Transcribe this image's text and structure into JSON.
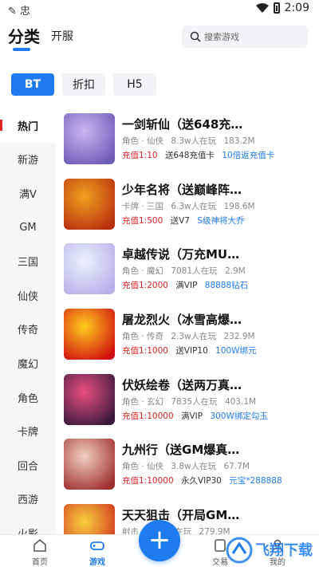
{
  "status_bar": {
    "left_icons": "✎ 忠",
    "time": "2:09"
  },
  "top_nav": {
    "active_tab": "分类",
    "second_tab": "开服",
    "search_placeholder": "搜索游戏"
  },
  "chips": [
    "BT",
    "折扣",
    "H5"
  ],
  "sidebar": [
    "热门",
    "新游",
    "满V",
    "GM",
    "三国",
    "仙侠",
    "传奇",
    "魔幻",
    "角色",
    "卡牌",
    "回合",
    "西游",
    "火影"
  ],
  "games": [
    {
      "title": "一剑斩仙（送648充…",
      "genre": "角色 · 仙侠",
      "players": "8.3w人在玩",
      "size": "183.2M",
      "recharge": "充值1:10",
      "gift": "送648充值卡",
      "extra": "10倍返充值卡",
      "colors": [
        "#c9b7f0",
        "#6d5bb8"
      ]
    },
    {
      "title": "少年名将（送巅峰阵…",
      "genre": "卡牌 · 三国",
      "players": "6.3w人在玩",
      "size": "198.6M",
      "recharge": "充值1:500",
      "gift": "送V7",
      "extra": "S级神将大乔",
      "colors": [
        "#f0a020",
        "#b83010"
      ]
    },
    {
      "title": "卓越传说（万充MU…",
      "genre": "角色 · 魔幻",
      "players": "7081人在玩",
      "size": "2.9M",
      "recharge": "充值1:2000",
      "gift": "满VIP",
      "extra": "88888钻石",
      "colors": [
        "#eef0ff",
        "#b8b0e8"
      ]
    },
    {
      "title": "屠龙烈火（冰雪高爆…",
      "genre": "角色 · 传奇",
      "players": "2.3w人在玩",
      "size": "232.9M",
      "recharge": "充值1:1000",
      "gift": "送VIP10",
      "extra": "100W绑元",
      "colors": [
        "#ffcc20",
        "#d01010"
      ]
    },
    {
      "title": "伏妖绘卷（送两万真…",
      "genre": "角色 · 玄幻",
      "players": "7835人在玩",
      "size": "403.1M",
      "recharge": "充值1:10000",
      "gift": "满VIP",
      "extra": "300W绑定勾玉",
      "colors": [
        "#e85080",
        "#3a1a3a"
      ]
    },
    {
      "title": "九州行（送GM爆真…",
      "genre": "角色 · 仙侠",
      "players": "3.8w人在玩",
      "size": "67.7M",
      "recharge": "充值1:10000",
      "gift": "永久VIP30",
      "extra": "元宝*288888",
      "colors": [
        "#f0d0c0",
        "#a03030"
      ]
    },
    {
      "title": "天天狙击（开局GM…",
      "genre": "射击",
      "players": "1.5w人在玩",
      "size": "279.9M",
      "recharge": "",
      "gift": "",
      "extra": "",
      "colors": [
        "#f8d040",
        "#d03020"
      ]
    }
  ],
  "bottom_nav": {
    "home": "首页",
    "games": "游戏",
    "trade": "交易",
    "mine": "我的"
  }
}
